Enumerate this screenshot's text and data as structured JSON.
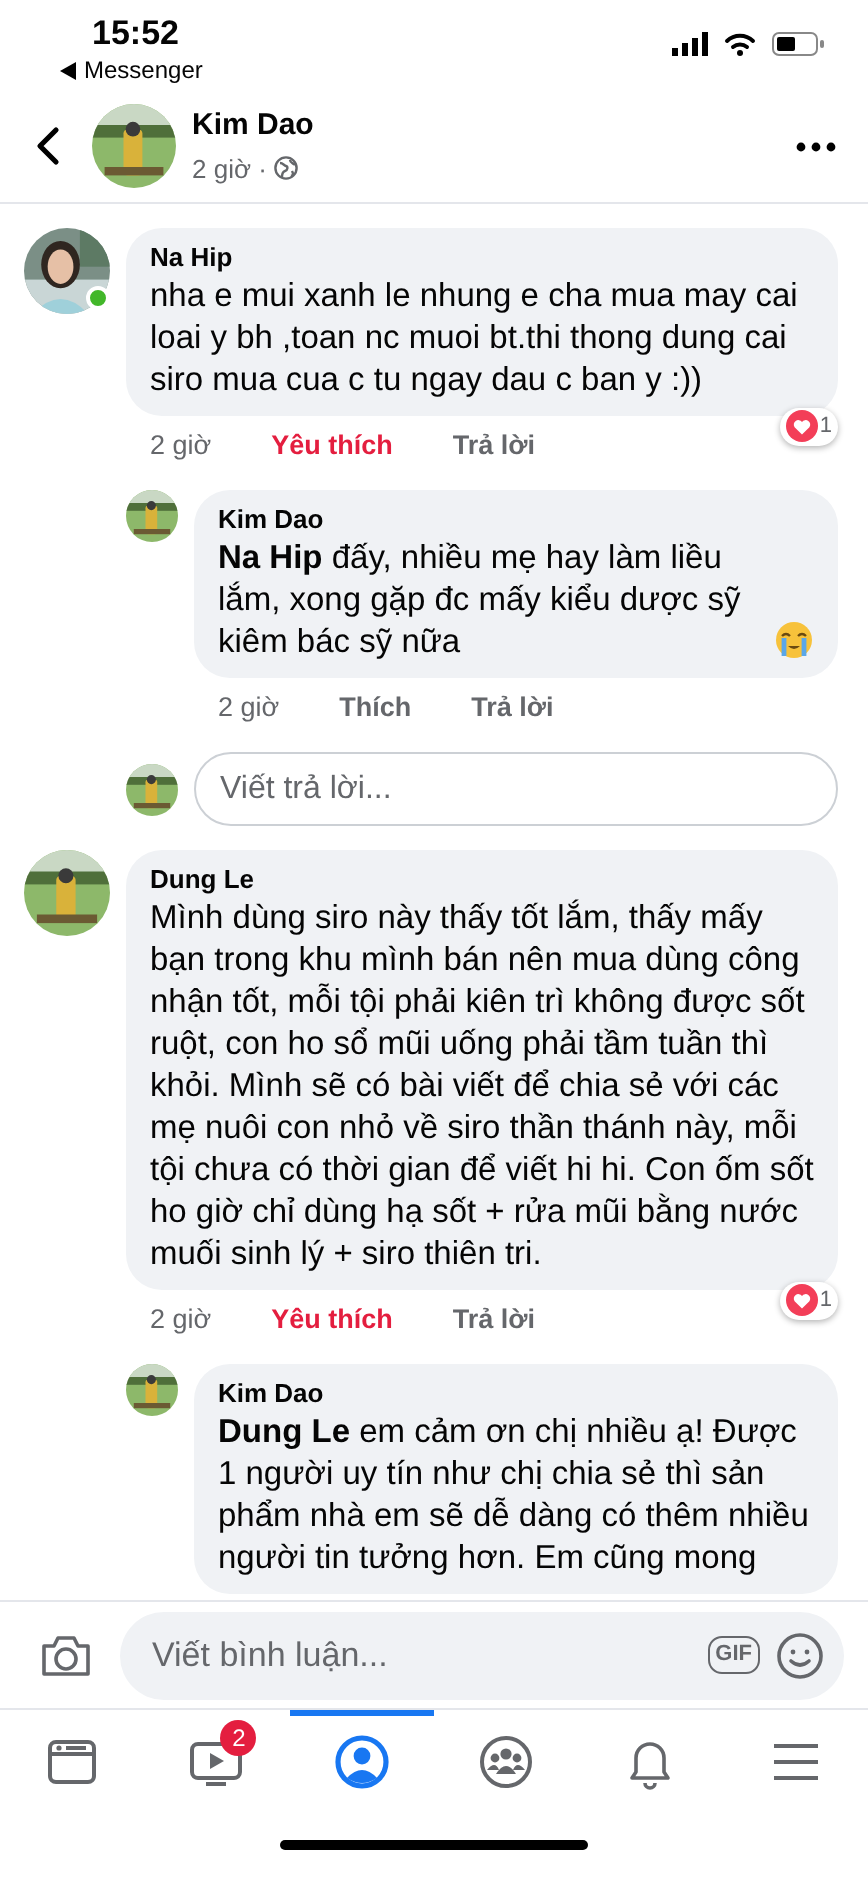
{
  "status_bar": {
    "time": "15:52",
    "back_label": "Messenger"
  },
  "header": {
    "name": "Kim Dao",
    "time": "2 giờ ·"
  },
  "comments": [
    {
      "author": "Na Hip",
      "online": true,
      "text": "nha e mui xanh le nhung e cha mua may cai loai y bh ,toan nc muoi bt.thi thong dung cai siro mua cua c tu ngay dau c ban y :))",
      "time": "2 giờ",
      "like_label": "Yêu thích",
      "liked": true,
      "reply_label": "Trả lời",
      "reactions": "1",
      "replies": [
        {
          "author": "Kim Dao",
          "text": "**Na Hip** đấy, nhiều mẹ hay làm liều lắm, xong gặp đc mấy kiểu dược sỹ kiêm bác sỹ nữa",
          "emoji": true,
          "time": "2 giờ",
          "like_label": "Thích",
          "liked": false,
          "reply_label": "Trả lời"
        }
      ],
      "reply_box": {
        "placeholder": "Viết trả lời..."
      }
    },
    {
      "author": "Dung Le",
      "online": false,
      "text": "Mình dùng siro này thấy tốt lắm, thấy mấy bạn trong khu mình bán nên mua dùng công nhận tốt, mỗi tội phải kiên trì không được sốt ruột, con ho sổ mũi uống phải tầm tuần thì khỏi. Mình sẽ có bài viết để chia sẻ với các mẹ nuôi con nhỏ về siro thần thánh này, mỗi tội chưa có thời gian để viết hi hi. Con ốm sốt ho giờ chỉ dùng hạ sốt + rửa mũi bằng nước muối sinh lý + siro thiên tri.",
      "time": "2 giờ",
      "like_label": "Yêu thích",
      "liked": true,
      "reply_label": "Trả lời",
      "reactions": "1",
      "replies": [
        {
          "author": "Kim Dao",
          "text": "**Dung Le** em cảm ơn chị nhiều ạ! Được 1 người uy tín như chị chia sẻ thì sản phẩm nhà em sẽ dễ dàng có thêm nhiều người tin tưởng hơn. Em cũng mong",
          "emoji": false
        }
      ]
    }
  ],
  "composer": {
    "placeholder": "Viết bình luận...",
    "gif_label": "GIF"
  },
  "tabs": [
    {
      "kind": "feed",
      "selected": false
    },
    {
      "kind": "video",
      "badge": "2",
      "selected": false
    },
    {
      "kind": "profile",
      "selected": true
    },
    {
      "kind": "groups",
      "selected": false
    },
    {
      "kind": "notifications",
      "selected": false
    },
    {
      "kind": "menu",
      "selected": false
    }
  ]
}
